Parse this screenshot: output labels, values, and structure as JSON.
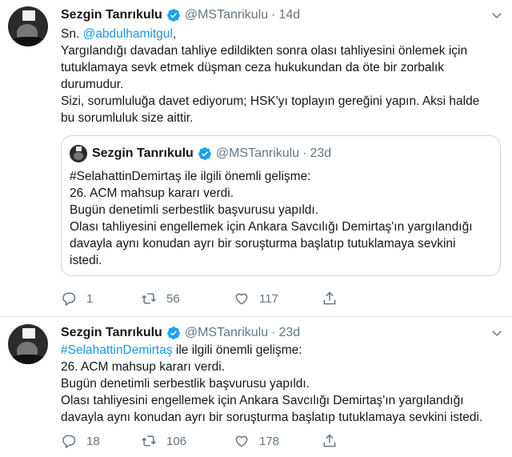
{
  "tweets": [
    {
      "author": {
        "name": "Sezgin Tanrıkulu",
        "handle": "@MSTanrikulu",
        "verified": true
      },
      "time": "14d",
      "text": {
        "mention_prefix": "Sn. ",
        "mention": "@abdulhamitgul",
        "mention_suffix": ",",
        "lines": [
          "Yargılandığı davadan tahliye edildikten sonra olası tahliyesini önlemek için",
          "tutuklamaya sevk etmek düşman ceza hukukundan da öte bir zorbalık",
          "durumudur.",
          "Sizi, sorumluluğa davet ediyorum; HSK'yı toplayın gereğini yapın. Aksi halde",
          "bu sorumluluk size aittir."
        ]
      },
      "quoted": {
        "author": {
          "name": "Sezgin Tanrıkulu",
          "handle": "@MSTanrikulu",
          "verified": true
        },
        "time": "23d",
        "lines": [
          "#SelahattinDemirtaş ile ilgili önemli gelişme:",
          "26. ACM mahsup kararı verdi.",
          "Bugün denetimli serbestlik başvurusu yapıldı.",
          "Olası tahliyesini engellemek için Ankara Savcılığı Demirtaş'ın yargılandığı",
          "davayla aynı konudan ayrı bir soruşturma başlatıp tutuklamaya sevkini",
          "istedi."
        ]
      },
      "actions": {
        "replies": "1",
        "retweets": "56",
        "likes": "117"
      }
    },
    {
      "author": {
        "name": "Sezgin Tanrıkulu",
        "handle": "@MSTanrikulu",
        "verified": true
      },
      "time": "23d",
      "text": {
        "hashtag": "#SelahattinDemirtaş",
        "hashtag_suffix": " ile ilgili önemli gelişme:",
        "lines": [
          "26. ACM mahsup kararı verdi.",
          "Bugün denetimli serbestlik başvurusu yapıldı.",
          "Olası tahliyesini engellemek için Ankara Savcılığı Demirtaş'ın yargılandığı",
          "davayla aynı konudan ayrı bir soruşturma başlatıp tutuklamaya sevkini istedi."
        ]
      },
      "actions": {
        "replies": "18",
        "retweets": "106",
        "likes": "178"
      }
    }
  ],
  "separator": "·",
  "colors": {
    "link": "#1b95e0",
    "verified": "#1da1f2",
    "muted": "#657786",
    "text": "#14171a"
  },
  "icons": [
    "verified-badge-icon",
    "caret-down-icon",
    "reply-icon",
    "retweet-icon",
    "like-icon",
    "share-icon"
  ]
}
